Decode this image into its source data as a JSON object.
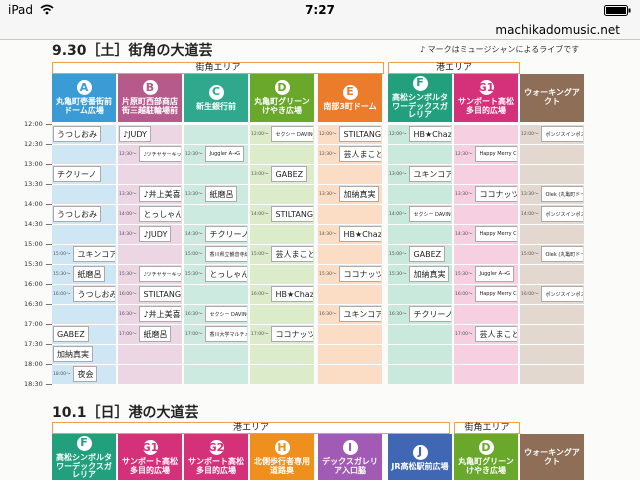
{
  "status": {
    "device": "iPad",
    "time": "7:27"
  },
  "browser": {
    "url": "machikadomusic.net"
  },
  "day1": {
    "date_title": "9.30［土］街角の大道芸",
    "note": "♪ マークはミュージシャンによるライブです",
    "zone1": "街角エリア",
    "zone2": "港エリア",
    "columns": [
      {
        "letter": "A",
        "name": "丸亀町壱番街前ドーム広場",
        "color": "#3a9bd5"
      },
      {
        "letter": "B",
        "name": "片原町西部商店街三越駐輪場前",
        "color": "#b65a8c"
      },
      {
        "letter": "C",
        "name": "新生銀行前",
        "color": "#2fa88e"
      },
      {
        "letter": "D",
        "name": "丸亀町グリーンけやき広場",
        "color": "#6aa82c"
      },
      {
        "letter": "E",
        "name": "南部3町ドーム",
        "color": "#ea7c2b"
      },
      {
        "letter": "F",
        "name": "高松シンボルタワーデックスガレリア",
        "color": "#22a07e"
      },
      {
        "letter": "G1",
        "name": "サンポート高松多目的広場",
        "color": "#d4317a"
      },
      {
        "letter": "",
        "name": "ウォーキングアクト",
        "color": "#8f6e58"
      }
    ],
    "times": [
      "12:00",
      "12:30",
      "13:00",
      "13:30",
      "14:00",
      "14:30",
      "15:00",
      "15:30",
      "16:00",
      "16:30",
      "17:00",
      "17:30",
      "18:00",
      "18:30"
    ],
    "cells": [
      {
        "c": 0,
        "r": 0,
        "t": "",
        "label": "うつしおみ"
      },
      {
        "c": 0,
        "r": 2,
        "t": "",
        "label": "チクリーノ"
      },
      {
        "c": 0,
        "r": 4,
        "t": "",
        "label": "うつしおみ"
      },
      {
        "c": 0,
        "r": 6,
        "t": "15:00〜",
        "label": "ユキンコアキラ"
      },
      {
        "c": 0,
        "r": 7,
        "t": "15:30〜",
        "label": "紙磨呂"
      },
      {
        "c": 0,
        "r": 8,
        "t": "16:00〜",
        "label": "うつしおみ"
      },
      {
        "c": 0,
        "r": 10,
        "t": "",
        "label": "GABEZ"
      },
      {
        "c": 0,
        "r": 11,
        "t": "",
        "label": "加納真実"
      },
      {
        "c": 0,
        "r": 12,
        "t": "18:00〜",
        "label": "夜会"
      },
      {
        "c": 1,
        "r": 0,
        "t": "",
        "label": "♪JUDY"
      },
      {
        "c": 1,
        "r": 1,
        "t": "12:30〜",
        "label": "♪ツチヤサーキット あいうみこ"
      },
      {
        "c": 1,
        "r": 3,
        "t": "13:30〜",
        "label": "♪井上美喜"
      },
      {
        "c": 1,
        "r": 4,
        "t": "14:00〜",
        "label": "とっしゃん"
      },
      {
        "c": 1,
        "r": 5,
        "t": "14:30〜",
        "label": "♪JUDY"
      },
      {
        "c": 1,
        "r": 7,
        "t": "15:30〜",
        "label": "♪ツチヤサーキット あいうみこ"
      },
      {
        "c": 1,
        "r": 8,
        "t": "16:00〜",
        "label": "STILTANGO"
      },
      {
        "c": 1,
        "r": 9,
        "t": "16:30〜",
        "label": "♪井上美喜"
      },
      {
        "c": 1,
        "r": 10,
        "t": "17:00〜",
        "label": "紙磨呂"
      },
      {
        "c": 2,
        "r": 1,
        "t": "12:30〜",
        "label": "Juggler A→G"
      },
      {
        "c": 2,
        "r": 3,
        "t": "13:30〜",
        "label": "紙磨呂"
      },
      {
        "c": 2,
        "r": 5,
        "t": "14:30〜",
        "label": "チクリーノ"
      },
      {
        "c": 2,
        "r": 6,
        "t": "15:00〜",
        "label": "香川県立観音寺総合高校 ハイテンション部"
      },
      {
        "c": 2,
        "r": 7,
        "t": "15:30〜",
        "label": "とっしゃん"
      },
      {
        "c": 2,
        "r": 9,
        "t": "16:30〜",
        "label": "セクシー DAVINCI"
      },
      {
        "c": 2,
        "r": 10,
        "t": "17:00〜",
        "label": "香川大学マルチメディア メルシー文クラブ"
      },
      {
        "c": 3,
        "r": 0,
        "t": "12:00〜",
        "label": "セクシー DAVINCI"
      },
      {
        "c": 3,
        "r": 2,
        "t": "13:00〜",
        "label": "GABEZ"
      },
      {
        "c": 3,
        "r": 4,
        "t": "14:00〜",
        "label": "STILTANGO"
      },
      {
        "c": 3,
        "r": 6,
        "t": "15:00〜",
        "label": "芸人まこと"
      },
      {
        "c": 3,
        "r": 8,
        "t": "16:00〜",
        "label": "HB★Chazz-K"
      },
      {
        "c": 3,
        "r": 10,
        "t": "17:00〜",
        "label": "ココナッツ山本"
      },
      {
        "c": 4,
        "r": 0,
        "t": "12:00〜",
        "label": "STILTANGO"
      },
      {
        "c": 4,
        "r": 1,
        "t": "12:30〜",
        "label": "芸人まこと"
      },
      {
        "c": 4,
        "r": 3,
        "t": "13:30〜",
        "label": "加納真実"
      },
      {
        "c": 4,
        "r": 5,
        "t": "14:30〜",
        "label": "HB★Chazz-K"
      },
      {
        "c": 4,
        "r": 7,
        "t": "15:30〜",
        "label": "ココナッツ山本"
      },
      {
        "c": 4,
        "r": 9,
        "t": "16:30〜",
        "label": "ユキンコアキラ"
      },
      {
        "c": 5,
        "r": 0,
        "t": "12:00〜",
        "label": "HB★Chazz-K"
      },
      {
        "c": 5,
        "r": 2,
        "t": "13:00〜",
        "label": "ユキンコアキラ"
      },
      {
        "c": 5,
        "r": 4,
        "t": "14:00〜",
        "label": "セクシー DAVINCI"
      },
      {
        "c": 5,
        "r": 6,
        "t": "15:00〜",
        "label": "GABEZ"
      },
      {
        "c": 5,
        "r": 7,
        "t": "15:30〜",
        "label": "加納真実"
      },
      {
        "c": 5,
        "r": 9,
        "t": "16:30〜",
        "label": "チクリーノ"
      },
      {
        "c": 6,
        "r": 1,
        "t": "12:30〜",
        "label": "Happy Merry Circus"
      },
      {
        "c": 6,
        "r": 3,
        "t": "13:30〜",
        "label": "ココナッツ山本"
      },
      {
        "c": 6,
        "r": 5,
        "t": "14:30〜",
        "label": "Happy Merry Circus"
      },
      {
        "c": 6,
        "r": 7,
        "t": "15:30〜",
        "label": "Juggler A→G"
      },
      {
        "c": 6,
        "r": 8,
        "t": "16:00〜",
        "label": "Happy Merry Circus"
      },
      {
        "c": 6,
        "r": 10,
        "t": "17:00〜",
        "label": "芸人まこと"
      },
      {
        "c": 7,
        "r": 0,
        "t": "12:00〜",
        "label": "ポンジスインポスガーボン (丸亀町壱番街〜)"
      },
      {
        "c": 7,
        "r": 3,
        "t": "13:30〜",
        "label": "Olek (丸亀町ドーム〜)"
      },
      {
        "c": 7,
        "r": 4,
        "t": "14:00〜",
        "label": "ポンジスインポスガーボン (丸亀町ドーム〜)"
      },
      {
        "c": 7,
        "r": 6,
        "t": "15:00〜",
        "label": "Olek (丸亀町ドーム〜)"
      },
      {
        "c": 7,
        "r": 8,
        "t": "16:00〜",
        "label": "ポンジスインポスガーボン (丸亀町ドーム〜)"
      }
    ]
  },
  "day2": {
    "date_title": "10.1［日］港の大道芸",
    "zone1": "港エリア",
    "zone2": "街角エリア",
    "columns": [
      {
        "letter": "F",
        "name": "高松シンボルタワーデックスガレリア",
        "color": "#22a07e"
      },
      {
        "letter": "G1",
        "name": "サンポート高松多目的広場",
        "color": "#d4317a"
      },
      {
        "letter": "G2",
        "name": "サンポート高松多目的広場",
        "color": "#d4317a"
      },
      {
        "letter": "H",
        "name": "北側歩行者専用道路奥",
        "color": "#ef8f1e"
      },
      {
        "letter": "I",
        "name": "デックスガレリア入口脇",
        "color": "#a15bb5"
      },
      {
        "letter": "J",
        "name": "JR高松駅前広場",
        "color": "#3f67b4"
      },
      {
        "letter": "D",
        "name": "丸亀町グリーンけやき広場",
        "color": "#6aa82c"
      },
      {
        "letter": "",
        "name": "ウォーキングアクト",
        "color": "#8f6e58"
      }
    ]
  }
}
